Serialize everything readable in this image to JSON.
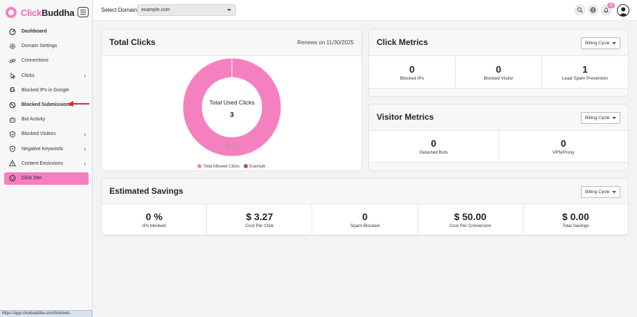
{
  "brand": {
    "name_part1": "Click",
    "name_part2": "Buddha"
  },
  "sidebar": {
    "items": [
      {
        "label": "Dashboard",
        "icon": "dashboard-icon",
        "chevron": false
      },
      {
        "label": "Domain Settings",
        "icon": "gear-icon",
        "chevron": false
      },
      {
        "label": "Connections",
        "icon": "link-icon",
        "chevron": false
      },
      {
        "label": "Clicks",
        "icon": "pointer-icon",
        "chevron": true
      },
      {
        "label": "Blocked IPs in Google",
        "icon": "google-icon",
        "chevron": false
      },
      {
        "label": "Blocked Submissions",
        "icon": "ban-icon",
        "chevron": false
      },
      {
        "label": "Bot Activity",
        "icon": "bot-icon",
        "chevron": false
      },
      {
        "label": "Blocked Visitors",
        "icon": "shield-icon",
        "chevron": true
      },
      {
        "label": "Negative Keywords",
        "icon": "shield-minus-icon",
        "chevron": true
      },
      {
        "label": "Content Exclusions",
        "icon": "warning-icon",
        "chevron": true
      },
      {
        "label": "Click Zen",
        "icon": "buddha-icon",
        "chevron": false
      }
    ],
    "status_url": "https://app.clickbuddha.com/blocked-submissions"
  },
  "topbar": {
    "domain_label": "Select Domain",
    "domain_value": "example.com",
    "notification_count": "10"
  },
  "total_clicks": {
    "title": "Total Clicks",
    "renews": "Renews on 11/30/2025",
    "center_label": "Total Used Clicks",
    "center_value": "3",
    "slice_label": "20000",
    "legend": [
      "Total Allowed Clicks",
      "Example"
    ]
  },
  "chart_data": {
    "type": "pie",
    "series": [
      {
        "name": "Total Allowed Clicks",
        "value": 20000,
        "color": "#f580c0"
      },
      {
        "name": "Example",
        "value": 3,
        "color": "#c2447e"
      }
    ],
    "center_label": "Total Used Clicks",
    "center_value": 3
  },
  "click_metrics": {
    "title": "Click Metrics",
    "billing": "Billing Cycle",
    "items": [
      {
        "value": "0",
        "label": "Blocked IPs"
      },
      {
        "value": "0",
        "label": "Blocked Visitor"
      },
      {
        "value": "1",
        "label": "Lead Spam Prevention"
      }
    ]
  },
  "visitor_metrics": {
    "title": "Visitor Metrics",
    "billing": "Billing Cycle",
    "items": [
      {
        "value": "0",
        "label": "Detected Bots"
      },
      {
        "value": "0",
        "label": "VPN/Proxy"
      }
    ]
  },
  "estimated_savings": {
    "title": "Estimated Savings",
    "billing": "Billing Cycle",
    "items": [
      {
        "value": "0 %",
        "label": "IPs blocked"
      },
      {
        "value": "$ 3.27",
        "label": "Cost Per Click"
      },
      {
        "value": "0",
        "label": "Spam Blocked"
      },
      {
        "value": "$ 50.00",
        "label": "Cost Per Conversion"
      },
      {
        "value": "$ 0.00",
        "label": "Total Savings"
      }
    ]
  },
  "colors": {
    "accent": "#f580c0",
    "accent_dark": "#c2447e",
    "arrow": "#e02b2b"
  }
}
